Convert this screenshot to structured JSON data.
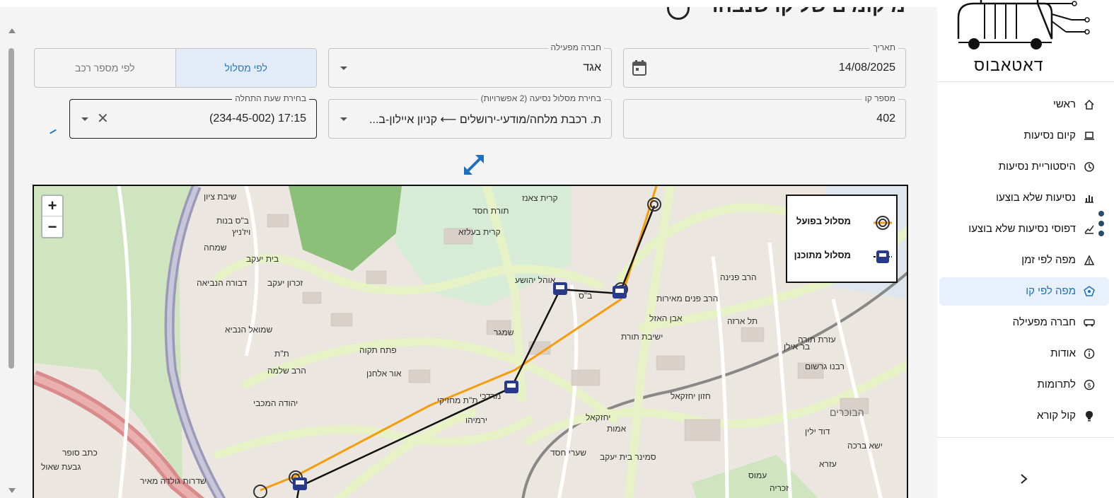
{
  "page": {
    "title": "מיקומים של קו שנבחר"
  },
  "filters": {
    "date": {
      "label": "תאריך",
      "value": "14/08/2025"
    },
    "operator": {
      "label": "חברה מפעילה",
      "value": "אגד"
    },
    "mode_toggle": {
      "by_route": "לפי מסלול",
      "by_vehicle": "לפי מספר רכב",
      "selected": "by_route"
    },
    "line_number": {
      "label": "מספר קו",
      "value": "402"
    },
    "route": {
      "label": "בחירת מסלול נסיעה (2 אפשרויות)",
      "value": "ת. רכבת מלחה/מודעי-ירושלים ⟵ קניון איילון-ב..."
    },
    "start_time": {
      "label": "בחירת שעת התחלה",
      "value": "17:15 (234-45-002)"
    }
  },
  "map": {
    "zoom_in": "+",
    "zoom_out": "−",
    "legend": {
      "actual_route": "מסלול בפועל",
      "planned_route": "מסלול מתוכנן"
    },
    "route_colors": {
      "actual": "#f59d0b",
      "planned": "#111111"
    },
    "labels": {
      "l1": "שיבת ציון",
      "l2": "ב\"ס בנות",
      "l3": "ויז'ניץ",
      "l4": "שמחה",
      "l5": "בית יעקב",
      "l6": "קרית צאנז",
      "l7": "תורת חסד",
      "l8": "קרית בעלזא",
      "l9": "אוהל יהושע",
      "l10": "פתח תקוה",
      "l11": "אור אלחנן",
      "l12": "ירמיהו",
      "l13": "עזרא",
      "l14": "תל ארזה",
      "l15": "בר אילן",
      "l16": "רבנו גרשום",
      "l17": "הבוכרים",
      "l18": "שמגר",
      "l19": "יחזקאל",
      "l20": "הרב פנינה",
      "l21": "דוד ילין",
      "l22": "ישא ברכה",
      "l23": "זכרון יעקב",
      "l24": "שדרות גולדה מאיר",
      "l25": "ת\"ת מחזיקי",
      "l26": "ב\"ס",
      "l27": "הרב שלמה",
      "l28": "מרדכי",
      "l29": "סמינר בית יעקב",
      "l30": "ישיבת תורת",
      "l31": "חזון יחזקאל",
      "l32": "אמות",
      "l33": "שערי חסד",
      "l34": "הרב פנים מאירות",
      "l35": "שמואל הנביא",
      "l36": "ת\"ת",
      "l37": "דבורה הנביאה",
      "l38": "יהודה המכבי",
      "l39": "גבעת שאול",
      "l40": "כתב סופר",
      "l41": "עזרת תורה",
      "l42": "עמוס",
      "l43": "אבן האזל",
      "l44": "זכריה"
    }
  },
  "sidebar": {
    "logo_text": "דאטאבוס",
    "items": [
      {
        "label": "ראשי",
        "icon": "home-icon"
      },
      {
        "label": "קיום נסיעות",
        "icon": "laptop-icon"
      },
      {
        "label": "היסטוריית נסיעות",
        "icon": "history-icon"
      },
      {
        "label": "נסיעות שלא בוצעו",
        "icon": "bar-chart-icon"
      },
      {
        "label": "דפוסי נסיעות שלא בוצעו",
        "icon": "line-chart-icon"
      },
      {
        "label": "מפה לפי זמן",
        "icon": "radar-icon"
      },
      {
        "label": "מפה לפי קו",
        "icon": "route-map-icon"
      },
      {
        "label": "חברה מפעילה",
        "icon": "bus-icon"
      },
      {
        "label": "אודות",
        "icon": "info-icon"
      },
      {
        "label": "לתרומות",
        "icon": "dollar-icon"
      },
      {
        "label": "קול קורא",
        "icon": "lightbulb-icon"
      }
    ],
    "selected_index": 6,
    "accent": "#1f6fc0"
  }
}
